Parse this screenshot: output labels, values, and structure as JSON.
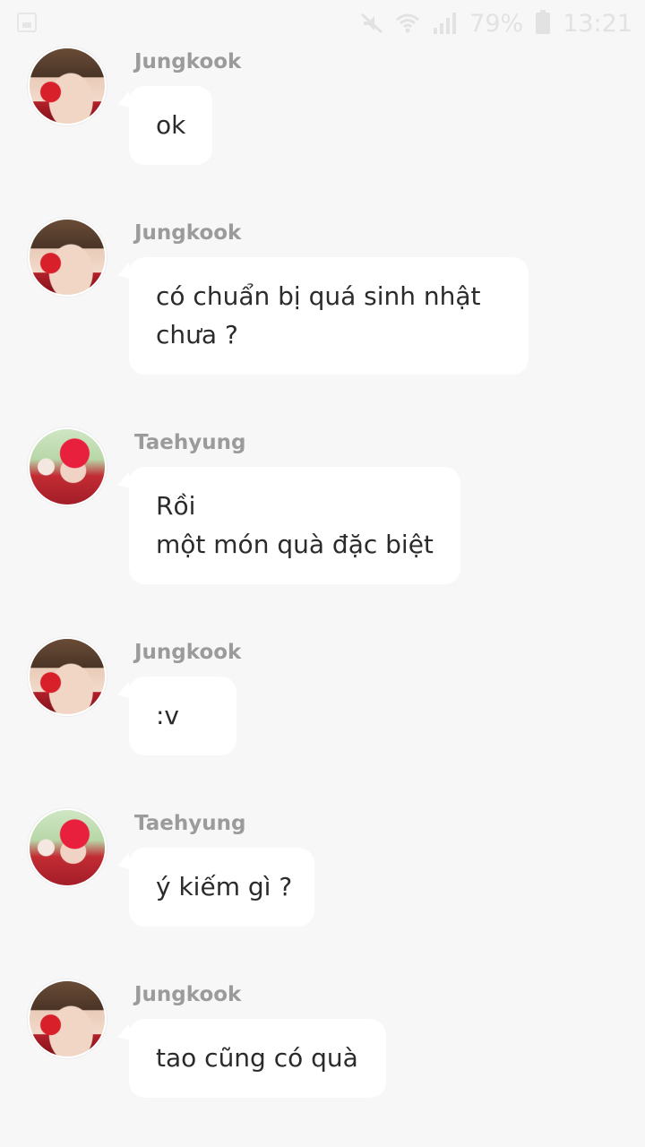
{
  "status_bar": {
    "battery": "79%",
    "time": "13:21",
    "icons": [
      "gallery-icon",
      "mute-icon",
      "wifi-icon",
      "signal-icon",
      "battery-icon"
    ]
  },
  "messages": [
    {
      "sender": "Jungkook",
      "avatar": "jungkook-avatar",
      "lines": [
        "ok"
      ]
    },
    {
      "sender": "Jungkook",
      "avatar": "jungkook-avatar",
      "lines": [
        "có chuẩn bị quá sinh nhật",
        "chưa ?"
      ]
    },
    {
      "sender": "Taehyung",
      "avatar": "taehyung-avatar",
      "lines": [
        "Rồi",
        "một món quà đặc biệt"
      ]
    },
    {
      "sender": "Jungkook",
      "avatar": "jungkook-avatar",
      "lines": [
        ":v"
      ]
    },
    {
      "sender": "Taehyung",
      "avatar": "taehyung-avatar",
      "lines": [
        "ý kiếm gì ?"
      ]
    },
    {
      "sender": "Jungkook",
      "avatar": "jungkook-avatar",
      "lines": [
        "tao cũng có quà"
      ]
    }
  ]
}
